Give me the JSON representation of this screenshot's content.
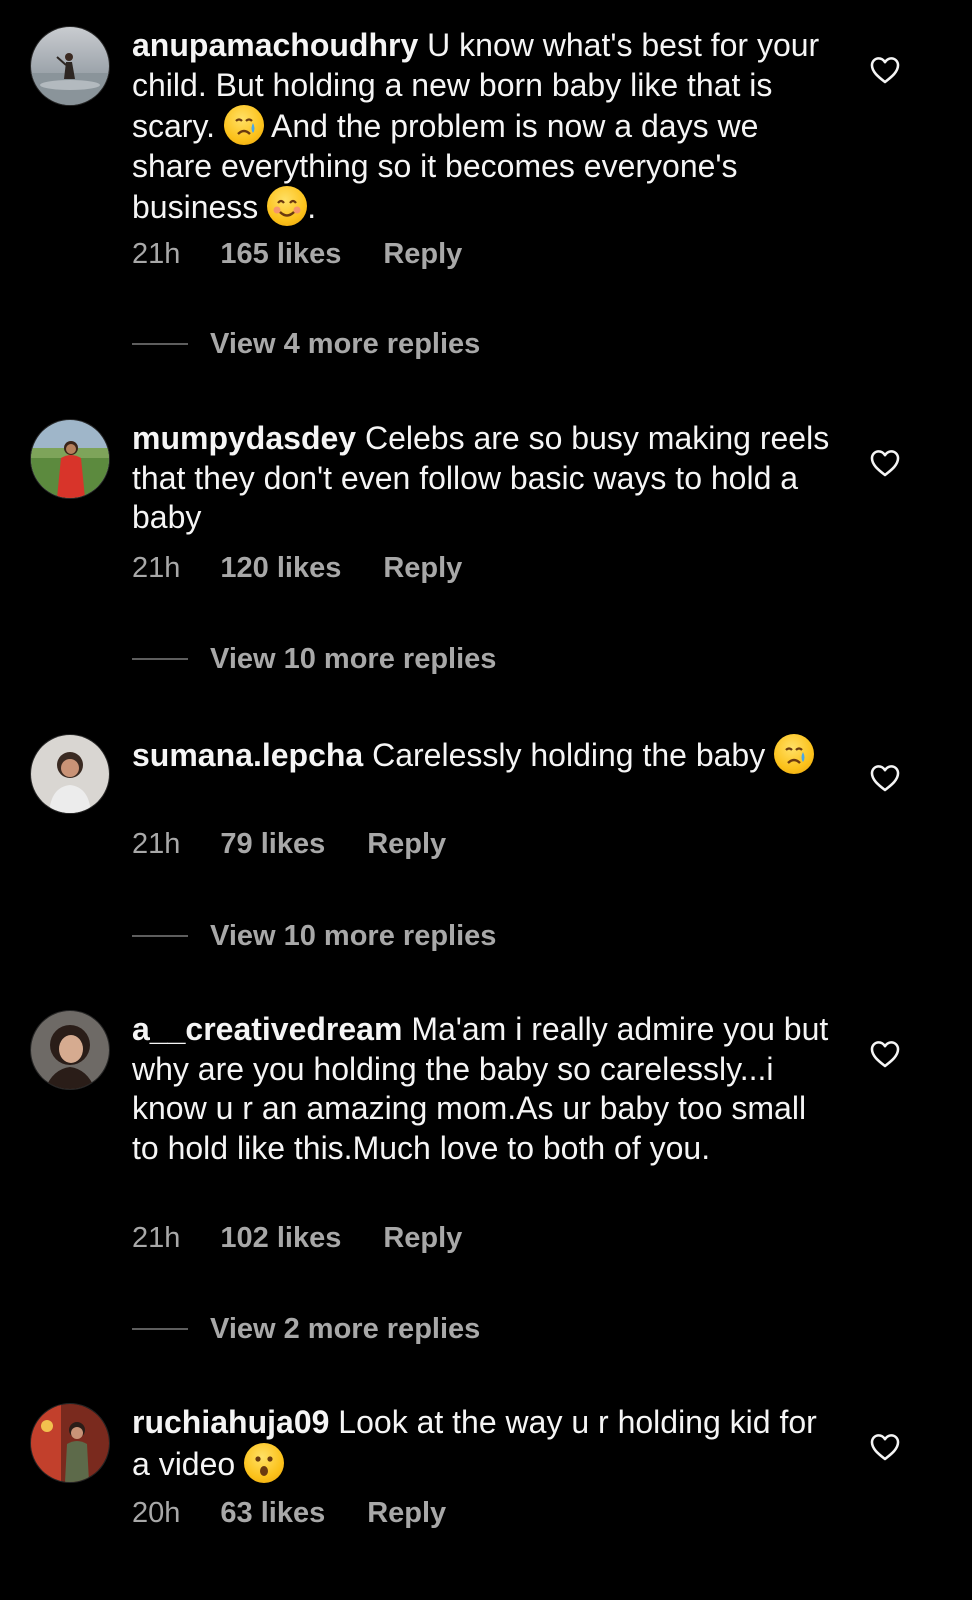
{
  "colors": {
    "background": "#000000",
    "primary_text": "#f5f5f5",
    "secondary_text": "#a8a8a8",
    "divider": "#5e5e5e"
  },
  "comments": [
    {
      "username": "anupamachoudhry",
      "text_a": "U know what's best for your child. But holding a new born baby like that is scary.",
      "emoji_a": "crying-face",
      "text_b": "And the problem is now a days we share everything so it becomes everyone's business",
      "emoji_b": "smiling-face",
      "text_c": ".",
      "time": "21h",
      "likes": "165 likes",
      "reply_label": "Reply",
      "view_replies": "View 4 more replies"
    },
    {
      "username": "mumpydasdey",
      "text_a": "Celebs are so busy making reels that they don't even follow basic ways to hold a baby",
      "time": "21h",
      "likes": "120 likes",
      "reply_label": "Reply",
      "view_replies": "View 10 more replies"
    },
    {
      "username": "sumana.lepcha",
      "text_a": "Carelessly holding the baby",
      "emoji_a": "crying-face",
      "time": "21h",
      "likes": "79 likes",
      "reply_label": "Reply",
      "view_replies": "View 10 more replies"
    },
    {
      "username": "a__creativedream",
      "text_a": "Ma'am i really admire you but why are you holding the baby so carelessly...i know u r an amazing mom.As ur baby too small to hold like this.Much love to both of you.",
      "time": "21h",
      "likes": "102 likes",
      "reply_label": "Reply",
      "view_replies": "View 2 more replies"
    },
    {
      "username": "ruchiahuja09",
      "text_a": "Look at the way u r holding kid for a video",
      "emoji_a": "surprised-face",
      "time": "20h",
      "likes": "63 likes",
      "reply_label": "Reply"
    }
  ]
}
